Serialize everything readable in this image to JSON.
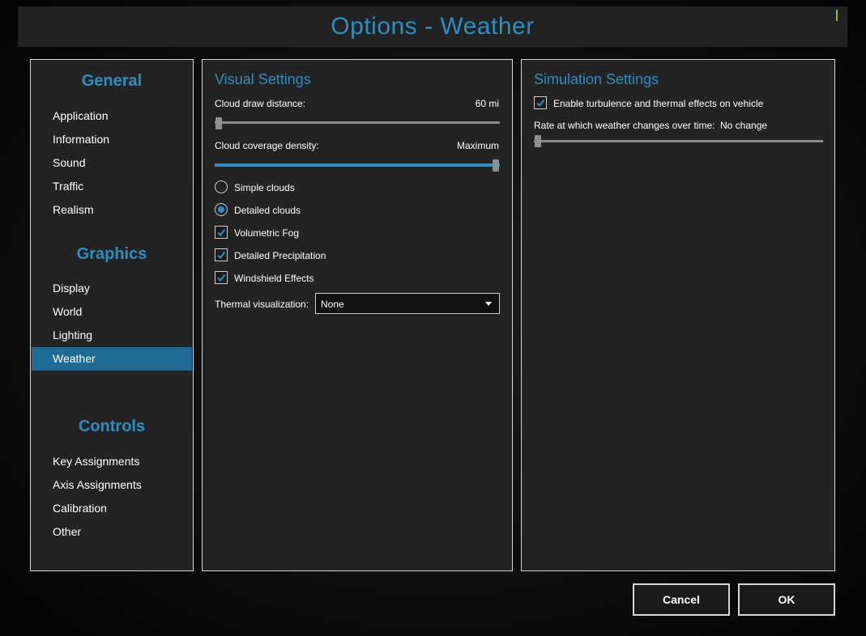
{
  "window": {
    "title": "Options - Weather"
  },
  "nav": {
    "sections": [
      {
        "header": "General",
        "items": [
          "Application",
          "Information",
          "Sound",
          "Traffic",
          "Realism"
        ]
      },
      {
        "header": "Graphics",
        "items": [
          "Display",
          "World",
          "Lighting",
          "Weather"
        ]
      },
      {
        "header": "Controls",
        "items": [
          "Key Assignments",
          "Axis Assignments",
          "Calibration",
          "Other"
        ]
      }
    ],
    "active": "Weather"
  },
  "visual": {
    "title": "Visual Settings",
    "cloud_draw_distance": {
      "label": "Cloud draw distance:",
      "value": "60 mi",
      "level": 0.0
    },
    "cloud_coverage_density": {
      "label": "Cloud coverage density:",
      "value": "Maximum",
      "level": 1.0
    },
    "clouds_radio": [
      {
        "label": "Simple clouds",
        "checked": false
      },
      {
        "label": "Detailed clouds",
        "checked": true
      }
    ],
    "checkboxes": [
      {
        "label": "Volumetric Fog",
        "checked": true
      },
      {
        "label": "Detailed Precipitation",
        "checked": true
      },
      {
        "label": "Windshield Effects",
        "checked": true
      }
    ],
    "thermal_visualization": {
      "label": "Thermal visualization:",
      "value": "None"
    }
  },
  "simulation": {
    "title": "Simulation Settings",
    "turbulence": {
      "label": "Enable turbulence and thermal effects on vehicle",
      "checked": true
    },
    "weather_change_rate": {
      "label": "Rate at which weather changes over time:",
      "value": "No change",
      "level": 0.0
    }
  },
  "buttons": {
    "cancel": "Cancel",
    "ok": "OK"
  },
  "colors": {
    "accent": "#2a8fc2",
    "nav_active": "#1d6b94",
    "panel_bg": "#232323",
    "border": "#d6d6d6"
  }
}
